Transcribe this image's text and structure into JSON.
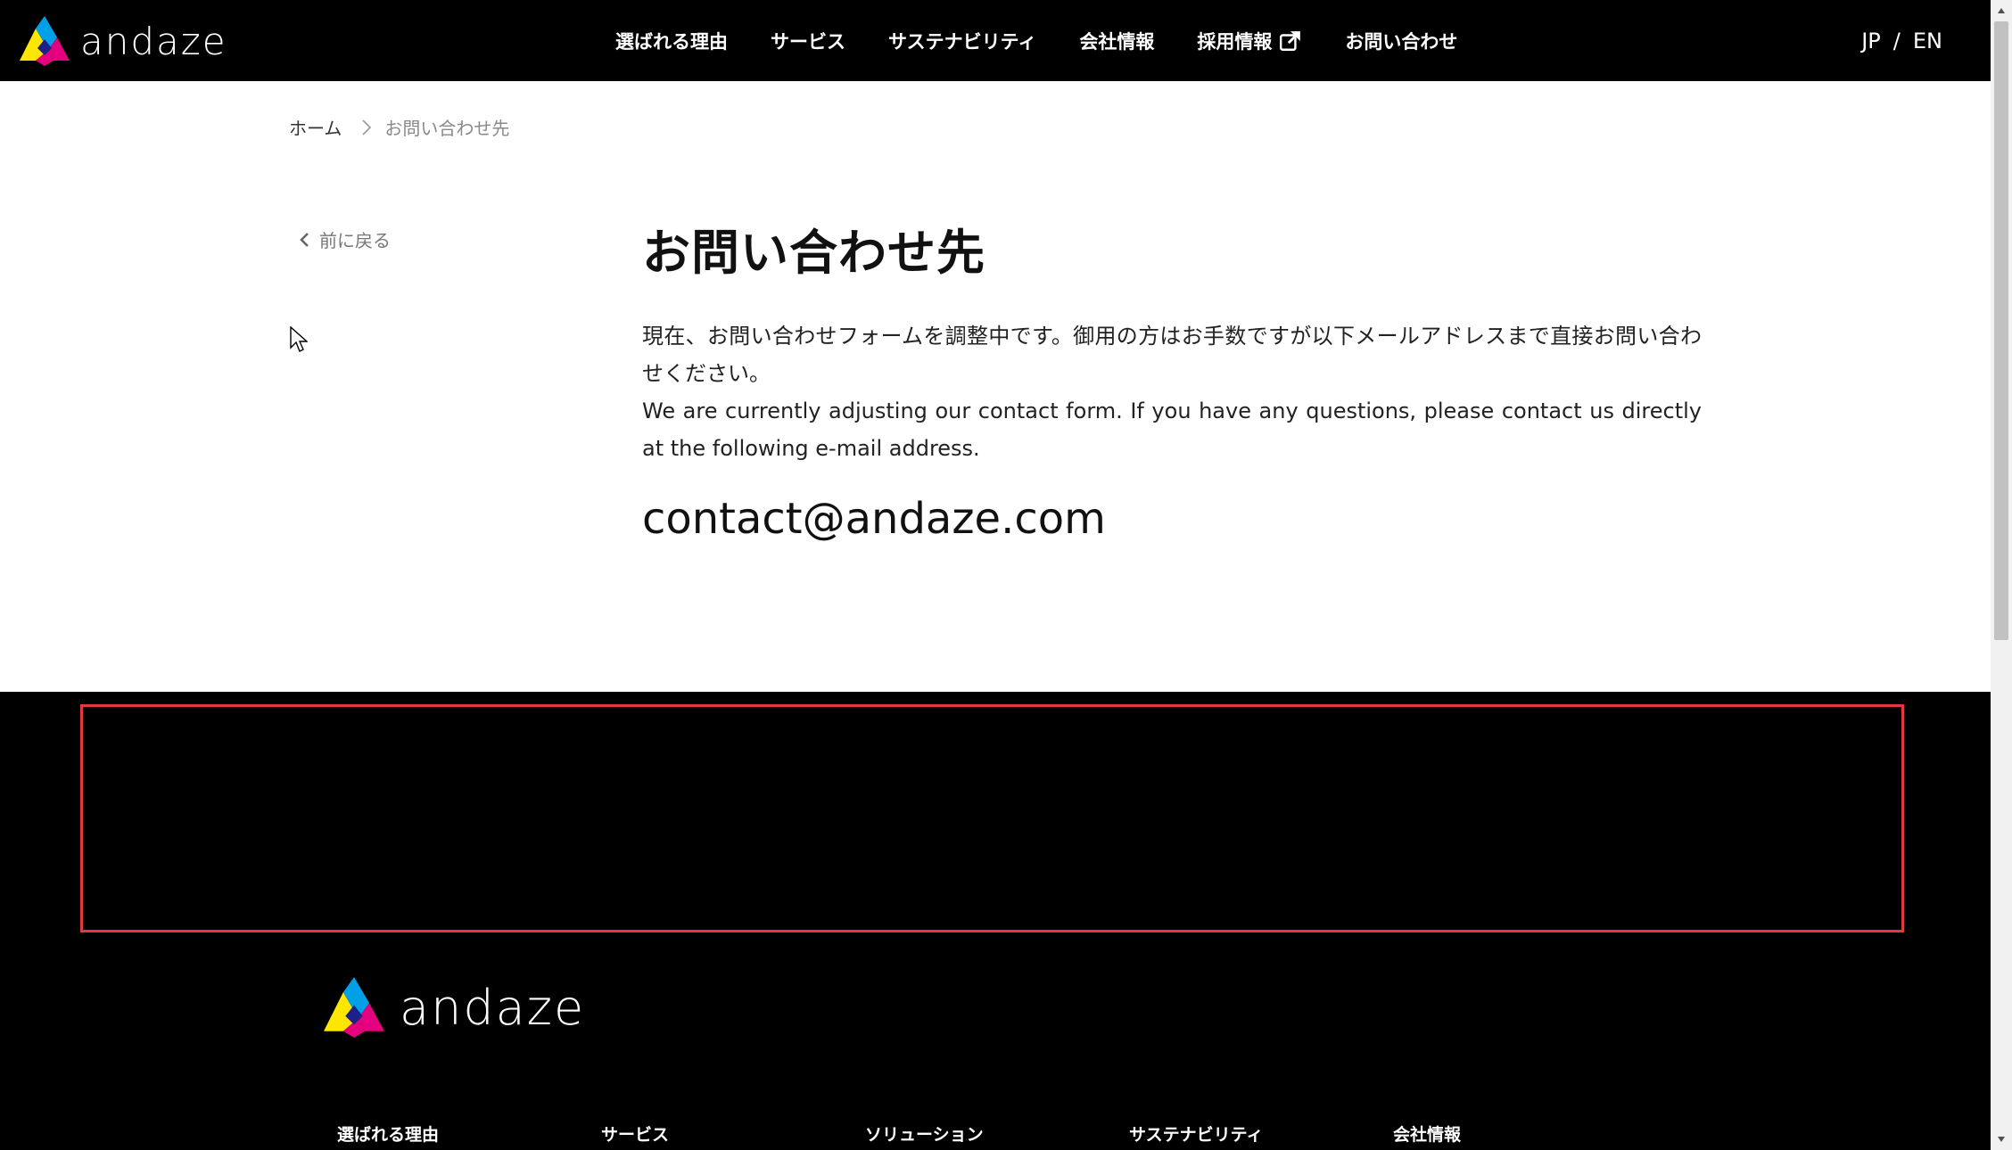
{
  "header": {
    "logo_text": "andaze",
    "nav": [
      {
        "label": "選ばれる理由"
      },
      {
        "label": "サービス"
      },
      {
        "label": "サステナビリティ"
      },
      {
        "label": "会社情報"
      },
      {
        "label": "採用情報",
        "icon": "external-link-icon"
      },
      {
        "label": "お問い合わせ"
      }
    ],
    "lang": {
      "jp": "JP",
      "separator": "/",
      "en": "EN"
    }
  },
  "breadcrumb": {
    "home": "ホーム",
    "current": "お問い合わせ先"
  },
  "back_link": "前に戻る",
  "main": {
    "title": "お問い合わせ先",
    "description_jp": "現在、お問い合わせフォームを調整中です。御用の方はお手数ですが以下メールアドレスまで直接お問い合わせください。",
    "description_en": "We are currently adjusting our contact form. If you have any questions, please contact us directly at the following e-mail address.",
    "email": "contact@andaze.com"
  },
  "footer": {
    "logo_text": "andaze",
    "nav": [
      {
        "label": "選ばれる理由"
      },
      {
        "label": "サービス"
      },
      {
        "label": "ソリューション"
      },
      {
        "label": "サステナビリティ"
      },
      {
        "label": "会社情報"
      }
    ]
  },
  "colors": {
    "header_bg": "#000000",
    "footer_bg": "#000000",
    "highlight_border": "#e03a3e",
    "logo_yellow": "#ffe600",
    "logo_cyan": "#00a0e9",
    "logo_magenta": "#e4007f"
  }
}
